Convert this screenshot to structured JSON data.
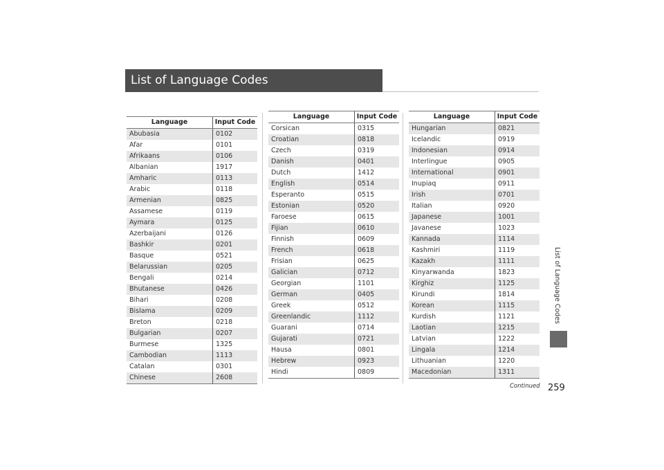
{
  "page": {
    "title": "List of Language Codes",
    "side_label": "List of Language Codes",
    "page_number": "259",
    "continued": "Continued"
  },
  "headers": {
    "language": "Language",
    "code": "Input Code"
  },
  "tables": [
    {
      "rows": [
        {
          "language": "Abubasia",
          "code": "0102"
        },
        {
          "language": "Afar",
          "code": "0101"
        },
        {
          "language": "Afrikaans",
          "code": "0106"
        },
        {
          "language": "Albanian",
          "code": "1917"
        },
        {
          "language": "Amharic",
          "code": "0113"
        },
        {
          "language": "Arabic",
          "code": "0118"
        },
        {
          "language": "Armenian",
          "code": "0825"
        },
        {
          "language": "Assamese",
          "code": "0119"
        },
        {
          "language": "Aymara",
          "code": "0125"
        },
        {
          "language": "Azerbaijani",
          "code": "0126"
        },
        {
          "language": "Bashkir",
          "code": "0201"
        },
        {
          "language": "Basque",
          "code": "0521"
        },
        {
          "language": "Belarussian",
          "code": "0205"
        },
        {
          "language": "Bengali",
          "code": "0214"
        },
        {
          "language": "Bhutanese",
          "code": "0426"
        },
        {
          "language": "Bihari",
          "code": "0208"
        },
        {
          "language": "Bislama",
          "code": "0209"
        },
        {
          "language": "Breton",
          "code": "0218"
        },
        {
          "language": "Bulgarian",
          "code": "0207"
        },
        {
          "language": "Burmese",
          "code": "1325"
        },
        {
          "language": "Cambodian",
          "code": "1113"
        },
        {
          "language": "Catalan",
          "code": "0301"
        },
        {
          "language": "Chinese",
          "code": "2608"
        }
      ]
    },
    {
      "rows": [
        {
          "language": "Corsican",
          "code": "0315"
        },
        {
          "language": "Croatian",
          "code": "0818"
        },
        {
          "language": "Czech",
          "code": "0319"
        },
        {
          "language": "Danish",
          "code": "0401"
        },
        {
          "language": "Dutch",
          "code": "1412"
        },
        {
          "language": "English",
          "code": "0514"
        },
        {
          "language": "Esperanto",
          "code": "0515"
        },
        {
          "language": "Estonian",
          "code": "0520"
        },
        {
          "language": "Faroese",
          "code": "0615"
        },
        {
          "language": "Fijian",
          "code": "0610"
        },
        {
          "language": "Finnish",
          "code": "0609"
        },
        {
          "language": "French",
          "code": "0618"
        },
        {
          "language": "Frisian",
          "code": "0625"
        },
        {
          "language": "Galician",
          "code": "0712"
        },
        {
          "language": "Georgian",
          "code": "1101"
        },
        {
          "language": "German",
          "code": "0405"
        },
        {
          "language": "Greek",
          "code": "0512"
        },
        {
          "language": "Greenlandic",
          "code": "1112"
        },
        {
          "language": "Guarani",
          "code": "0714"
        },
        {
          "language": "Gujarati",
          "code": "0721"
        },
        {
          "language": "Hausa",
          "code": "0801"
        },
        {
          "language": "Hebrew",
          "code": "0923"
        },
        {
          "language": "Hindi",
          "code": "0809"
        }
      ]
    },
    {
      "rows": [
        {
          "language": "Hungarian",
          "code": "0821"
        },
        {
          "language": "Icelandic",
          "code": "0919"
        },
        {
          "language": "Indonesian",
          "code": "0914"
        },
        {
          "language": "Interlingue",
          "code": "0905"
        },
        {
          "language": "International",
          "code": "0901"
        },
        {
          "language": "Inupiaq",
          "code": "0911"
        },
        {
          "language": "Irish",
          "code": "0701"
        },
        {
          "language": "Italian",
          "code": "0920"
        },
        {
          "language": "Japanese",
          "code": "1001"
        },
        {
          "language": "Javanese",
          "code": "1023"
        },
        {
          "language": "Kannada",
          "code": "1114"
        },
        {
          "language": "Kashmiri",
          "code": "1119"
        },
        {
          "language": "Kazakh",
          "code": "1111"
        },
        {
          "language": "Kinyarwanda",
          "code": "1823"
        },
        {
          "language": "Kirghiz",
          "code": "1125"
        },
        {
          "language": "Kirundi",
          "code": "1814"
        },
        {
          "language": "Korean",
          "code": "1115"
        },
        {
          "language": "Kurdish",
          "code": "1121"
        },
        {
          "language": "Laotian",
          "code": "1215"
        },
        {
          "language": "Latvian",
          "code": "1222"
        },
        {
          "language": "Lingala",
          "code": "1214"
        },
        {
          "language": "Lithuanian",
          "code": "1220"
        },
        {
          "language": "Macedonian",
          "code": "1311"
        }
      ]
    }
  ]
}
